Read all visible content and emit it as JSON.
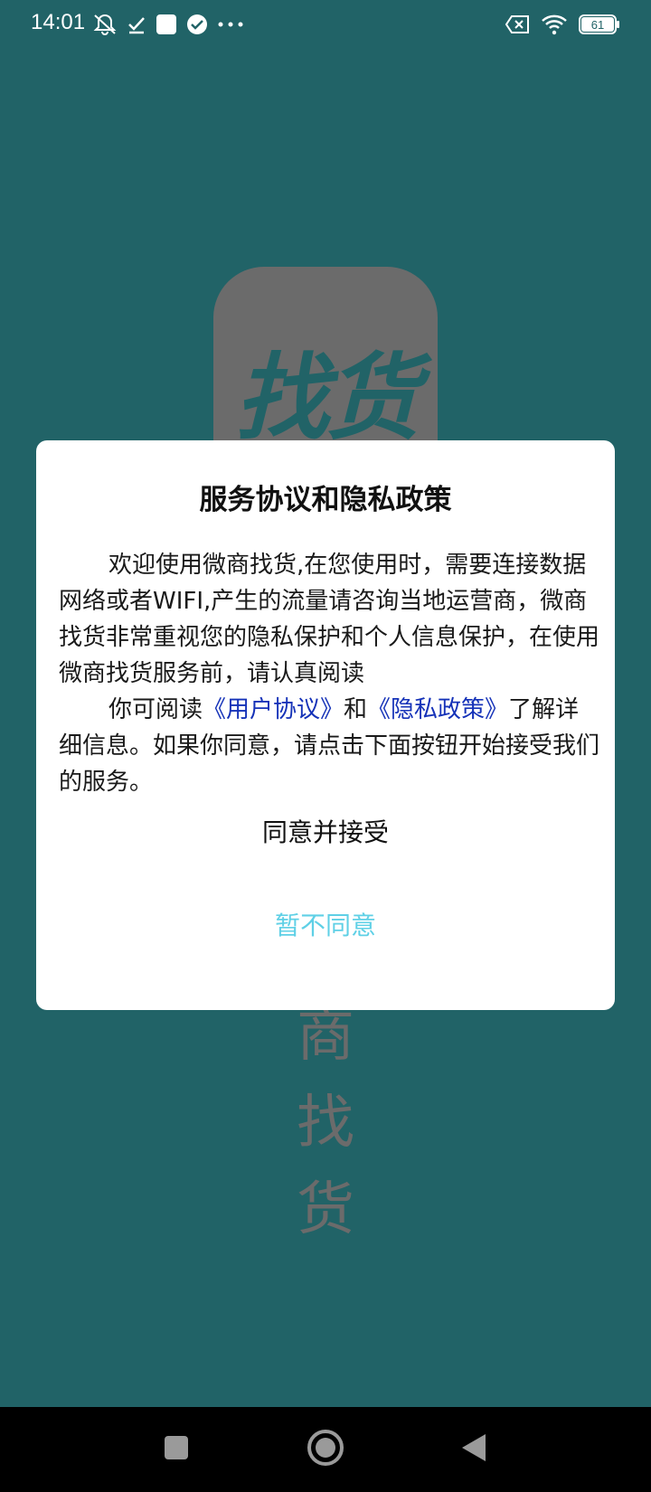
{
  "status_bar": {
    "time": "14:01",
    "battery_level": "61",
    "left_icons": [
      "notification-muted-icon",
      "check-icon",
      "square-icon",
      "verified-check-icon",
      "more-dots-icon"
    ],
    "right_icons": [
      "sim-off-icon",
      "wifi-icon",
      "battery-icon"
    ]
  },
  "splash": {
    "logo_text": "找货",
    "vertical_chars": [
      "商",
      "找",
      "货"
    ]
  },
  "dialog": {
    "title": "服务协议和隐私政策",
    "paragraph1": "欢迎使用微商找货,在您使用时，需要连接数据网络或者WIFI,产生的流量请咨询当地运营商，微商找货非常重视您的隐私保护和个人信息保护，在使用微商找货服务前，请认真阅读",
    "paragraph2_prefix": "你可阅读",
    "user_agreement_link": "《用户协议》",
    "paragraph2_and": "和",
    "privacy_policy_link": "《隐私政策》",
    "paragraph2_suffix": "了解详细信息。如果你同意，请点击下面按钮开始接受我们的服务。",
    "agree_button": "同意并接受",
    "disagree_button": "暂不同意"
  },
  "colors": {
    "background": "#216367",
    "splash_gray": "#6b6b6b",
    "link": "#1532b8",
    "disagree": "#5fd0e6"
  }
}
